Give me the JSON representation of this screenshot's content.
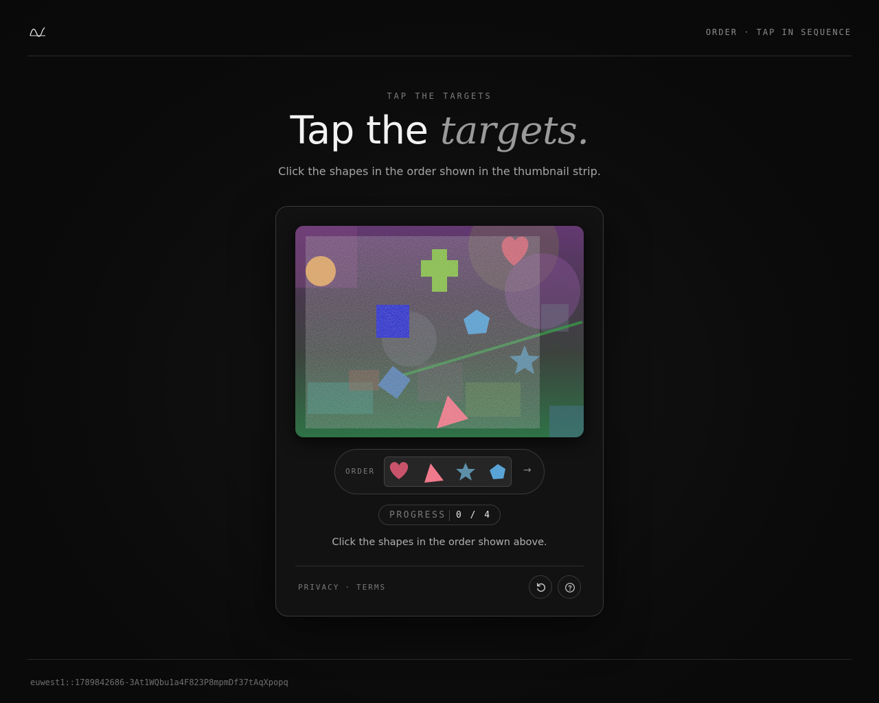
{
  "header": {
    "logo_icon": "wave-logo-icon",
    "right_text": "ORDER · TAP IN SEQUENCE"
  },
  "hero": {
    "eyebrow": "TAP THE TARGETS",
    "title_plain": "Tap the",
    "title_emphasis": "targets.",
    "subtitle": "Click the shapes in the order shown in the thumbnail strip."
  },
  "challenge": {
    "canvas_shapes": [
      "circle",
      "cross",
      "heart",
      "square",
      "pentagon",
      "star",
      "diamond",
      "triangle"
    ],
    "order_label": "ORDER",
    "order_sequence": [
      "heart",
      "triangle",
      "star",
      "pentagon"
    ],
    "order_arrow": "→",
    "progress_label": "PROGRESS",
    "progress_value": "0 / 4",
    "progress_done": 0,
    "progress_total": 4,
    "instruction": "Click the shapes in the order shown above.",
    "privacy_label": "PRIVACY",
    "separator": "·",
    "terms_label": "TERMS",
    "reload_icon": "reload-icon",
    "help_icon": "help-icon"
  },
  "footer": {
    "session_id": "euwest1::1789842686-3At1WQbu1a4F823P8mpmDf37tAqXpopq"
  },
  "colors": {
    "background": "#0b0b0b",
    "card": "#121212",
    "heart": "#c9536a",
    "triangle": "#f07a8c",
    "star": "#5d8fa8",
    "pentagon": "#5aa3d6",
    "square": "#2a2fd0",
    "cross": "#8ac24a",
    "circle": "#e0a868"
  }
}
